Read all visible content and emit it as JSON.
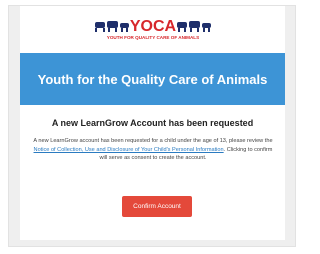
{
  "logo": {
    "text": "YOCA",
    "tagline": "YOUTH FOR QUALITY CARE OF ANIMALS"
  },
  "banner": {
    "title": "Youth for the Quality Care of Animals"
  },
  "message": {
    "heading": "A new LearnGrow Account has been requested",
    "intro": "A new LearnGrow account has been requested for a child under the age of 13, please review the ",
    "link_text": "Notice of Collection, Use and Disclosure of Your Child's Personal Information",
    "outro": ". Clicking to confirm will serve as consent to create the account."
  },
  "button": {
    "label": "Confirm Account"
  },
  "colors": {
    "banner": "#3d94d6",
    "button": "#e4493a",
    "logo_red": "#d7272b",
    "logo_navy": "#1f2f6b",
    "link": "#2a7bc1"
  }
}
